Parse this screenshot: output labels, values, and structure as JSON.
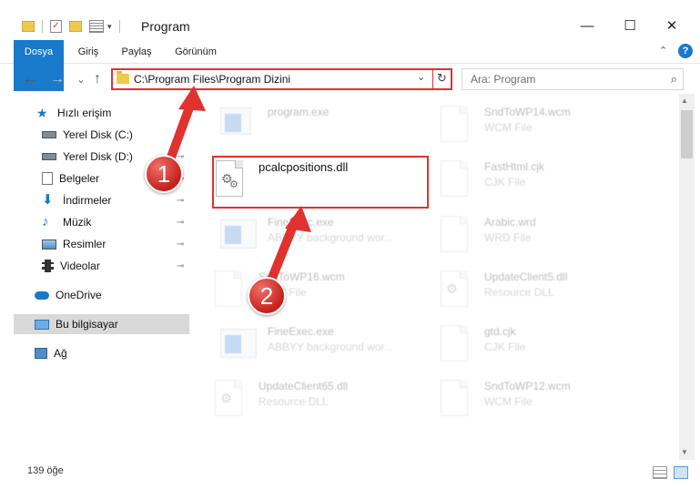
{
  "window": {
    "title": "Program",
    "minimize_glyph": "—",
    "maximize_glyph": "☐",
    "close_glyph": "✕",
    "help_glyph": "?",
    "collapse_glyph": "⌃"
  },
  "ribbon": {
    "tabs": [
      {
        "label": "Dosya"
      },
      {
        "label": "Giriş"
      },
      {
        "label": "Paylaş"
      },
      {
        "label": "Görünüm"
      }
    ]
  },
  "address": {
    "path": "C:\\Program Files\\Program Dizini",
    "dropdown_glyph": "⌄",
    "refresh_glyph": "↻"
  },
  "nav": {
    "back_glyph": "←",
    "forward_glyph": "→",
    "recent_glyph": "⌄",
    "up_glyph": "↑"
  },
  "search": {
    "placeholder": "Ara: Program",
    "icon_glyph": "⌕"
  },
  "sidebar": {
    "items": [
      {
        "label": "Hızlı erişim",
        "icon": "star-icon"
      },
      {
        "label": "Yerel Disk (C:)",
        "icon": "drive-icon"
      },
      {
        "label": "Yerel Disk (D:)",
        "icon": "drive-icon"
      },
      {
        "label": "Belgeler",
        "icon": "document-icon"
      },
      {
        "label": "İndirmeler",
        "icon": "download-icon"
      },
      {
        "label": "Müzik",
        "icon": "music-icon"
      },
      {
        "label": "Resimler",
        "icon": "pictures-icon"
      },
      {
        "label": "Videolar",
        "icon": "video-icon"
      },
      {
        "label": "OneDrive",
        "icon": "cloud-icon"
      },
      {
        "label": "Bu bilgisayar",
        "icon": "computer-icon"
      },
      {
        "label": "Ağ",
        "icon": "network-icon"
      }
    ],
    "pin_glyph": "📌"
  },
  "files": [
    {
      "name": "program.exe",
      "type": "",
      "icon": "program-icon"
    },
    {
      "name": "SndToWP14.wcm",
      "type": "WCM File",
      "icon": "document-icon"
    },
    {
      "name": "pcalcpositions.dll",
      "type": "",
      "icon": "dll-gear-icon"
    },
    {
      "name": "FastHtml.cjk",
      "type": "CJK File",
      "icon": "document-icon"
    },
    {
      "name": "FineExec.exe",
      "type": "ABBYY background wor...",
      "icon": "app-icon"
    },
    {
      "name": "Arabic.wrd",
      "type": "WRD File",
      "icon": "document-icon"
    },
    {
      "name": "SndToWP16.wcm",
      "type": "WCM File",
      "icon": "document-icon"
    },
    {
      "name": "UpdateClient5.dll",
      "type": "Resource DLL",
      "icon": "dll-gear-icon"
    },
    {
      "name": "FineExec.exe",
      "type": "ABBYY background wor...",
      "icon": "app-icon"
    },
    {
      "name": "gtd.cjk",
      "type": "CJK File",
      "icon": "document-icon"
    },
    {
      "name": "UpdateClient65.dll",
      "type": "Resource DLL",
      "icon": "dll-gear-icon"
    },
    {
      "name": "SndToWP12.wcm",
      "type": "WCM File",
      "icon": "document-icon"
    }
  ],
  "status": {
    "count": "139 öğe"
  },
  "annotations": {
    "step1": "1",
    "step2": "2",
    "color": "#e0322e"
  }
}
